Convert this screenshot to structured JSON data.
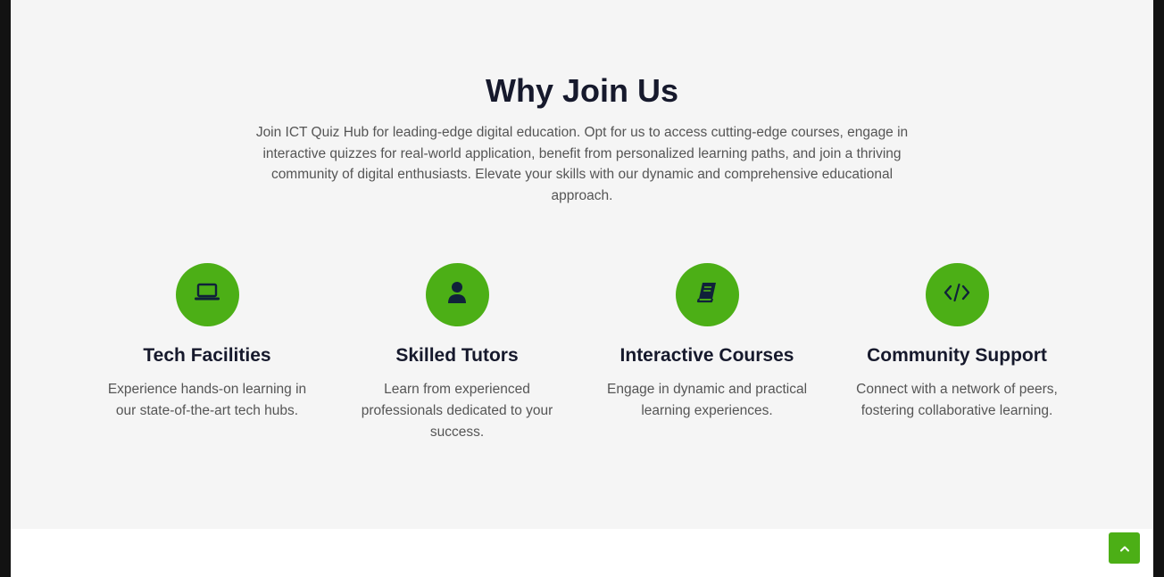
{
  "why": {
    "title": "Why Join Us",
    "description": "Join ICT Quiz Hub for leading-edge digital education. Opt for us to access cutting-edge courses, engage in interactive quizzes for real-world application, benefit from personalized learning paths, and join a thriving community of digital enthusiasts. Elevate your skills with our dynamic and comprehensive educational approach.",
    "features": [
      {
        "icon": "laptop-icon",
        "title": "Tech Facilities",
        "text": "Experience hands-on learning in our state-of-the-art tech hubs."
      },
      {
        "icon": "user-icon",
        "title": "Skilled Tutors",
        "text": "Learn from experienced professionals dedicated to your success."
      },
      {
        "icon": "book-icon",
        "title": "Interactive Courses",
        "text": "Engage in dynamic and practical learning experiences."
      },
      {
        "icon": "code-icon",
        "title": "Community Support",
        "text": "Connect with a network of peers, fostering collaborative learning."
      }
    ]
  },
  "scroll_top": {
    "icon": "chevron-up-icon"
  },
  "colors": {
    "accent": "#4caf16",
    "heading": "#16192c",
    "body_text": "#555555",
    "section_bg": "#f5f5f5"
  }
}
